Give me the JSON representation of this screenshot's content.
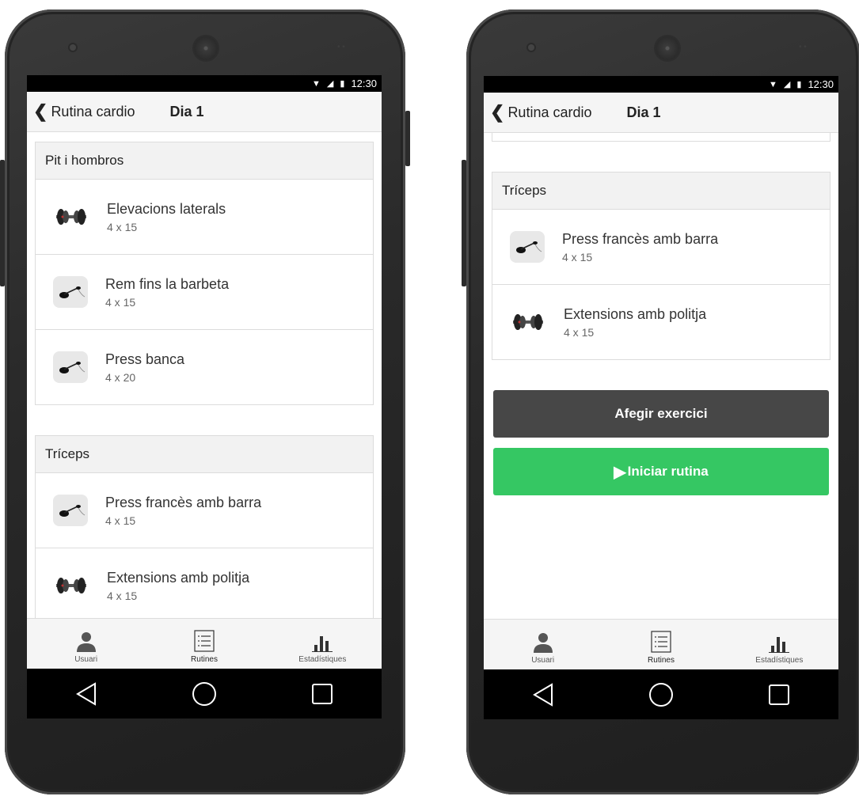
{
  "status": {
    "time": "12:30"
  },
  "appbar": {
    "back_label": "Rutina cardio",
    "day_title": "Dia 1"
  },
  "groups": {
    "chest": {
      "title": "Pit i hombros",
      "items": [
        {
          "name": "Elevacions laterals",
          "sets": "4 x 15",
          "icon": "dumbbell-icon"
        },
        {
          "name": "Rem fins la barbeta",
          "sets": "4 x 15",
          "icon": "cable-handle-icon"
        },
        {
          "name": "Press banca",
          "sets": "4 x 20",
          "icon": "cable-handle-icon"
        }
      ]
    },
    "triceps": {
      "title": "Tríceps",
      "items": [
        {
          "name": "Press francès amb barra",
          "sets": "4 x 15",
          "icon": "cable-handle-icon"
        },
        {
          "name": "Extensions amb politja",
          "sets": "4 x 15",
          "icon": "dumbbell-icon"
        }
      ]
    }
  },
  "actions": {
    "add_label": "Afegir exercici",
    "start_label": "Iniciar rutina"
  },
  "tabs": {
    "user": "Usuari",
    "routines": "Rutines",
    "stats": "Estadístiques"
  },
  "colors": {
    "start_button": "#35c763",
    "add_button": "#474747"
  }
}
